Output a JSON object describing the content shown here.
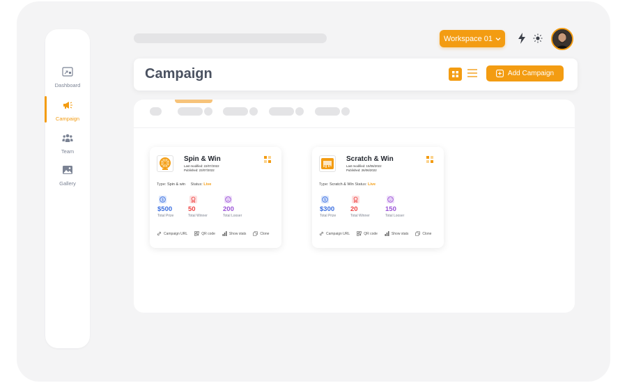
{
  "sidebar": {
    "items": [
      {
        "label": "Dashboard",
        "icon": "dashboard-icon"
      },
      {
        "label": "Campaign",
        "icon": "megaphone-icon",
        "active": true
      },
      {
        "label": "Team",
        "icon": "team-icon"
      },
      {
        "label": "Gallery",
        "icon": "gallery-icon"
      }
    ]
  },
  "topbar": {
    "workspace_label": "Workspace 01"
  },
  "header": {
    "title": "Campaign",
    "add_button_label": "Add Campaign"
  },
  "colors": {
    "accent": "#f39c12",
    "prize_blue": "#3b6fe0",
    "winner_red": "#ef4444",
    "looser_purple": "#9a52d6"
  },
  "cards": [
    {
      "title": "Spin & Win",
      "last_modified": "Last modified: 22/07/2022",
      "published": "Published:      23/07/2022",
      "type_label": "Type:",
      "type_value": "Spin & win",
      "status_label": "Status:",
      "status_value": "Live",
      "stats": [
        {
          "value": "$500",
          "label": "Total Prize"
        },
        {
          "value": "50",
          "label": "Total Winner"
        },
        {
          "value": "200",
          "label": "Total Looser"
        }
      ],
      "actions": [
        "Campaign URL",
        "QR code",
        "Show stats",
        "Clone"
      ]
    },
    {
      "title": "Scratch & Win",
      "last_modified": "Last modified: 15/06/2022",
      "published": "Published:      26/06/2022",
      "type_label": "Type:",
      "type_value": "Scratch & Win",
      "status_label": "Status:",
      "status_value": "Live",
      "stats": [
        {
          "value": "$300",
          "label": "Total Prize"
        },
        {
          "value": "20",
          "label": "Total Winner"
        },
        {
          "value": "150",
          "label": "Total Looser"
        }
      ],
      "actions": [
        "Campaign URL",
        "QR code",
        "Show stats",
        "Clone"
      ]
    }
  ]
}
